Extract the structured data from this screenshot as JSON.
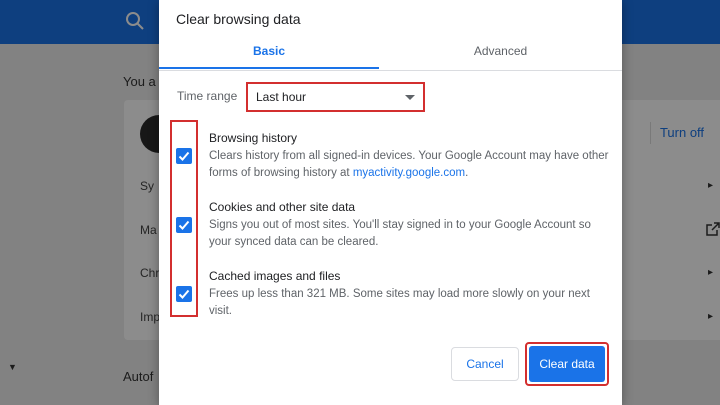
{
  "background": {
    "you_are": "You a",
    "turn_off": "Turn off",
    "rows": [
      "Sy",
      "Ma",
      "Chr",
      "Imp"
    ],
    "autofill": "Autof"
  },
  "dialog": {
    "title": "Clear browsing data",
    "tabs": [
      {
        "label": "Basic",
        "selected": true
      },
      {
        "label": "Advanced",
        "selected": false
      }
    ],
    "time_range": {
      "label": "Time range",
      "value": "Last hour"
    },
    "options": [
      {
        "title": "Browsing history",
        "description_before": "Clears history from all signed-in devices. Your Google Account may have other forms of browsing history at ",
        "link": "myactivity.google.com",
        "description_after": ".",
        "checked": true
      },
      {
        "title": "Cookies and other site data",
        "description": "Signs you out of most sites. You'll stay signed in to your Google Account so your synced data can be cleared.",
        "checked": true
      },
      {
        "title": "Cached images and files",
        "description": "Frees up less than 321 MB. Some sites may load more slowly on your next visit.",
        "checked": true
      }
    ],
    "buttons": {
      "cancel": "Cancel",
      "clear": "Clear data"
    }
  },
  "colors": {
    "accent": "#1a73e8",
    "highlight": "#d32f2f"
  }
}
